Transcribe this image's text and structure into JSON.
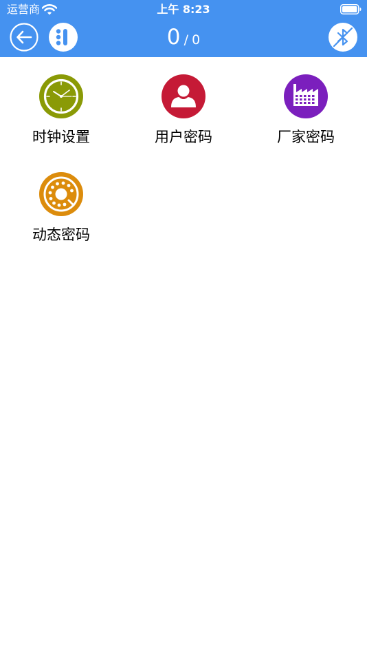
{
  "status_bar": {
    "carrier": "运营商",
    "time": "上午 8:23"
  },
  "header": {
    "count_current": "0",
    "count_separator": "/",
    "count_total": "0"
  },
  "menu": [
    {
      "label": "时钟设置",
      "icon": "clock-icon",
      "color": "#8a9a06"
    },
    {
      "label": "用户密码",
      "icon": "user-icon",
      "color": "#c51a36"
    },
    {
      "label": "厂家密码",
      "icon": "factory-icon",
      "color": "#7b1fbd"
    },
    {
      "label": "动态密码",
      "icon": "rotary-dial-icon",
      "color": "#dc8c0c"
    }
  ],
  "colors": {
    "header_bg": "#4592f0",
    "background": "#ffffff"
  }
}
